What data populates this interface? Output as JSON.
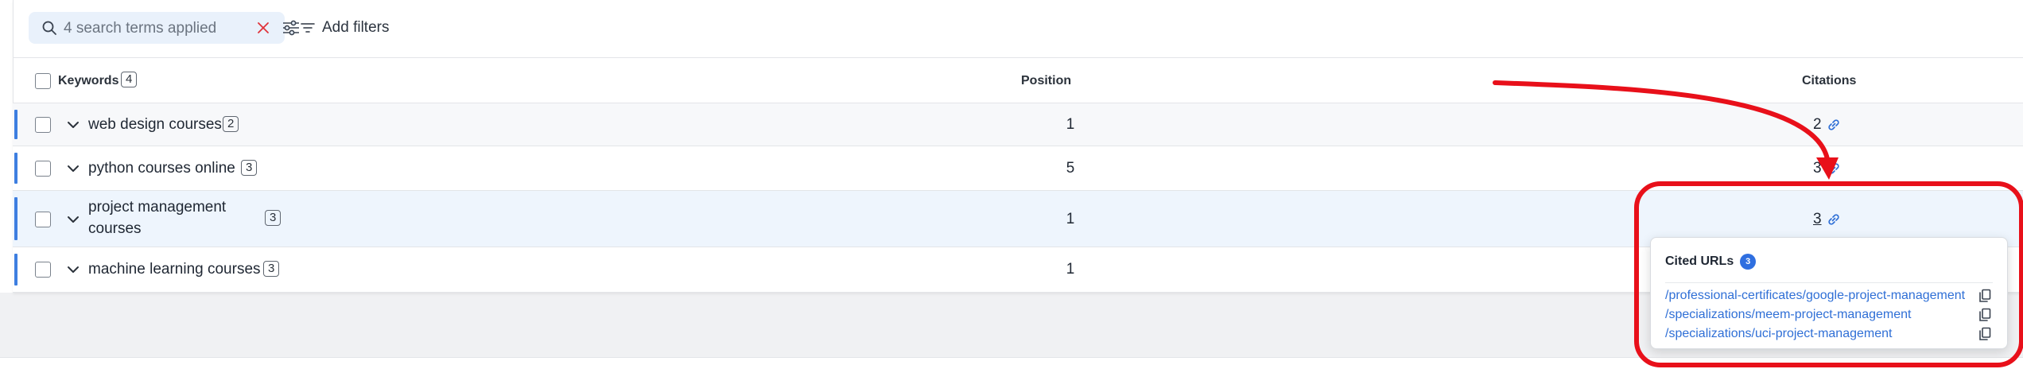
{
  "toolbar": {
    "search_placeholder": "4 search terms applied",
    "add_filters_label": "Add filters"
  },
  "table": {
    "headers": {
      "keywords": "Keywords",
      "keywords_count": "4",
      "position": "Position",
      "citations": "Citations"
    },
    "rows": [
      {
        "keyword": "web design courses",
        "count": "2",
        "position": "1",
        "citations": "2"
      },
      {
        "keyword": "python courses online",
        "count": "3",
        "position": "5",
        "citations": "3"
      },
      {
        "keyword_line1": "project management",
        "keyword_line2": "courses",
        "count": "3",
        "position": "1",
        "citations": "3"
      },
      {
        "keyword": "machine learning courses",
        "count": "3",
        "position": "1"
      }
    ]
  },
  "popover": {
    "title": "Cited URLs",
    "count": "3",
    "urls": [
      "/professional-certificates/google-project-management",
      "/specializations/meem-project-management",
      "/specializations/uci-project-management"
    ]
  },
  "colors": {
    "accent": "#3d7ee0",
    "link": "#2f6fd6",
    "annotation": "#e8101a",
    "search_bg": "#e9f1fb"
  },
  "icons": [
    "search-icon",
    "clear-x-icon",
    "tune-sliders-icon",
    "filter-lines-icon",
    "chevron-down-icon",
    "link-icon",
    "copy-icon"
  ]
}
